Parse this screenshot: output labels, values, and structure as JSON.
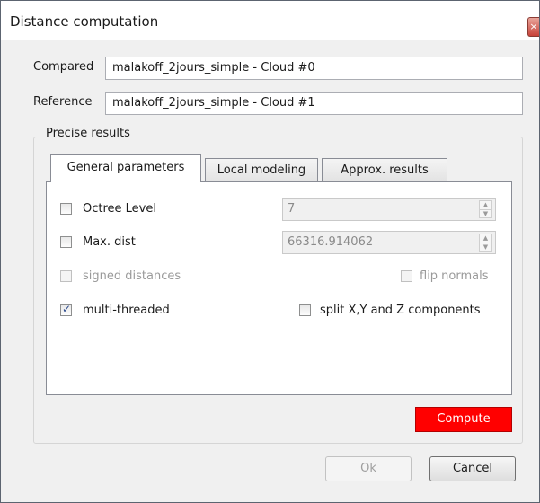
{
  "window": {
    "title": "Distance computation",
    "close_glyph": "×"
  },
  "fields": {
    "compared_label": "Compared",
    "compared_value": "malakoff_2jours_simple - Cloud #0",
    "reference_label": "Reference",
    "reference_value": "malakoff_2jours_simple - Cloud #1"
  },
  "precise_results": {
    "group_title": "Precise results",
    "tabs": [
      {
        "label": "General parameters",
        "active": true
      },
      {
        "label": "Local modeling",
        "active": false
      },
      {
        "label": "Approx. results",
        "active": false
      }
    ],
    "octree_level": {
      "label": "Octree Level",
      "checked": false,
      "value": "7"
    },
    "max_dist": {
      "label": "Max. dist",
      "checked": false,
      "value": "66316.914062"
    },
    "signed_distances": {
      "label": "signed distances",
      "checked": false,
      "enabled": false
    },
    "flip_normals": {
      "label": "flip normals",
      "checked": false,
      "enabled": false
    },
    "multi_threaded": {
      "label": "multi-threaded",
      "checked": true,
      "check_glyph": "✓"
    },
    "split_components": {
      "label": "split X,Y and Z components",
      "checked": false
    },
    "spin_up_glyph": "▲",
    "spin_down_glyph": "▼",
    "compute_label": "Compute"
  },
  "buttons": {
    "ok_label": "Ok",
    "cancel_label": "Cancel"
  },
  "colors": {
    "compute_button": "#ff0000",
    "check_mark": "#2c4b8e"
  }
}
